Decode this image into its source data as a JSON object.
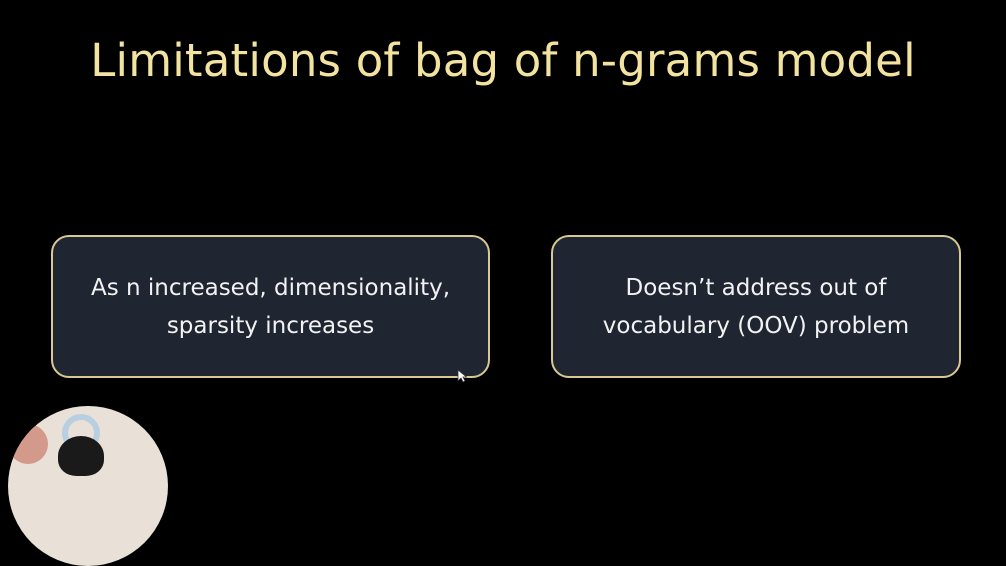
{
  "slide": {
    "title": "Limitations of bag of n-grams model",
    "cards": [
      {
        "lines": [
          "As n increased, dimensionality,",
          "sparsity increases"
        ]
      },
      {
        "lines": [
          "Doesn’t address out of",
          "vocabulary (OOV) problem"
        ]
      }
    ]
  },
  "colors": {
    "background": "#000000",
    "title": "#f3e3a0",
    "card_fill": "#1f2631",
    "card_border": "#d9c88f",
    "card_text": "#f2f2f2"
  },
  "icons": {
    "cursor": "mouse-pointer-icon"
  }
}
